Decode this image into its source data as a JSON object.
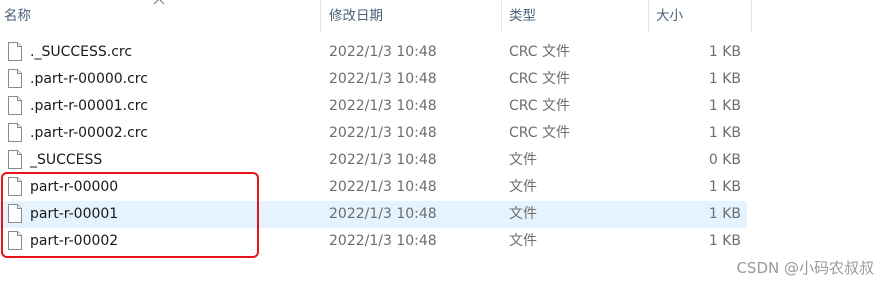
{
  "columns": {
    "name": "名称",
    "date": "修改日期",
    "type": "类型",
    "size": "大小"
  },
  "files": [
    {
      "name": "._SUCCESS.crc",
      "date": "2022/1/3 10:48",
      "type": "CRC 文件",
      "size": "1 KB"
    },
    {
      "name": ".part-r-00000.crc",
      "date": "2022/1/3 10:48",
      "type": "CRC 文件",
      "size": "1 KB"
    },
    {
      "name": ".part-r-00001.crc",
      "date": "2022/1/3 10:48",
      "type": "CRC 文件",
      "size": "1 KB"
    },
    {
      "name": ".part-r-00002.crc",
      "date": "2022/1/3 10:48",
      "type": "CRC 文件",
      "size": "1 KB"
    },
    {
      "name": "_SUCCESS",
      "date": "2022/1/3 10:48",
      "type": "文件",
      "size": "0 KB"
    },
    {
      "name": "part-r-00000",
      "date": "2022/1/3 10:48",
      "type": "文件",
      "size": "1 KB"
    },
    {
      "name": "part-r-00001",
      "date": "2022/1/3 10:48",
      "type": "文件",
      "size": "1 KB"
    },
    {
      "name": "part-r-00002",
      "date": "2022/1/3 10:48",
      "type": "文件",
      "size": "1 KB"
    }
  ],
  "hovered_row": "part-r-00001",
  "icon": "file-icon",
  "annotation_color": "#e8141b",
  "hover_color": "#e5f3ff",
  "watermark": "CSDN @小码农叔叔"
}
